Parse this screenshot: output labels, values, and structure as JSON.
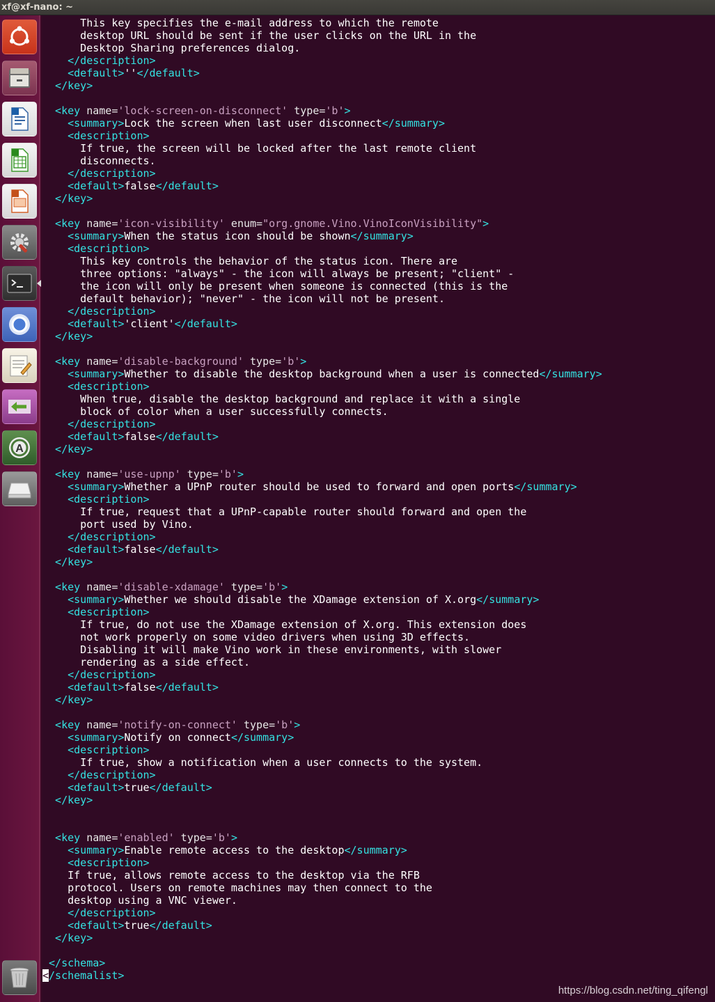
{
  "window": {
    "title": "xf@xf-nano: ~"
  },
  "launcher": {
    "items": [
      {
        "name": "ubuntu-dash-icon"
      },
      {
        "name": "files-icon"
      },
      {
        "name": "libreoffice-writer-icon"
      },
      {
        "name": "libreoffice-calc-icon"
      },
      {
        "name": "libreoffice-impress-icon"
      },
      {
        "name": "system-settings-icon"
      },
      {
        "name": "terminal-icon",
        "active": true
      },
      {
        "name": "chromium-icon"
      },
      {
        "name": "text-editor-icon"
      },
      {
        "name": "remote-desktop-icon"
      },
      {
        "name": "software-updater-icon"
      },
      {
        "name": "drive-icon"
      }
    ],
    "trash": {
      "name": "trash-icon"
    }
  },
  "watermark": "https://blog.csdn.net/ting_qifengl",
  "colors": {
    "tag": "#34e2e2",
    "text": "#ffffff",
    "value": "#c8a0c0",
    "background": "#300a24"
  },
  "lines": [
    [
      [
        "t",
        "      This key specifies the e-mail address to which the remote"
      ]
    ],
    [
      [
        "t",
        "      desktop URL should be sent if the user clicks on the URL in the"
      ]
    ],
    [
      [
        "t",
        "      Desktop Sharing preferences dialog."
      ]
    ],
    [
      [
        "g",
        "    </description>"
      ]
    ],
    [
      [
        "g",
        "    <default>"
      ],
      [
        "t",
        "''"
      ],
      [
        "g",
        "</default>"
      ]
    ],
    [
      [
        "g",
        "  </key>"
      ]
    ],
    [
      [
        "t",
        ""
      ]
    ],
    [
      [
        "g",
        "  <key "
      ],
      [
        "a",
        "name="
      ],
      [
        "v",
        "'lock-screen-on-disconnect'"
      ],
      [
        "a",
        " type="
      ],
      [
        "v",
        "'b'"
      ],
      [
        "g",
        ">"
      ]
    ],
    [
      [
        "g",
        "    <summary>"
      ],
      [
        "t",
        "Lock the screen when last user disconnect"
      ],
      [
        "g",
        "</summary>"
      ]
    ],
    [
      [
        "g",
        "    <description>"
      ]
    ],
    [
      [
        "t",
        "      If true, the screen will be locked after the last remote client"
      ]
    ],
    [
      [
        "t",
        "      disconnects."
      ]
    ],
    [
      [
        "g",
        "    </description>"
      ]
    ],
    [
      [
        "g",
        "    <default>"
      ],
      [
        "t",
        "false"
      ],
      [
        "g",
        "</default>"
      ]
    ],
    [
      [
        "g",
        "  </key>"
      ]
    ],
    [
      [
        "t",
        ""
      ]
    ],
    [
      [
        "g",
        "  <key "
      ],
      [
        "a",
        "name="
      ],
      [
        "v",
        "'icon-visibility'"
      ],
      [
        "a",
        " enum="
      ],
      [
        "v",
        "\"org.gnome.Vino.VinoIconVisibility\""
      ],
      [
        "g",
        ">"
      ]
    ],
    [
      [
        "g",
        "    <summary>"
      ],
      [
        "t",
        "When the status icon should be shown"
      ],
      [
        "g",
        "</summary>"
      ]
    ],
    [
      [
        "g",
        "    <description>"
      ]
    ],
    [
      [
        "t",
        "      This key controls the behavior of the status icon. There are"
      ]
    ],
    [
      [
        "t",
        "      three options: \"always\" - the icon will always be present; \"client\" -"
      ]
    ],
    [
      [
        "t",
        "      the icon will only be present when someone is connected (this is the"
      ]
    ],
    [
      [
        "t",
        "      default behavior); \"never\" - the icon will not be present."
      ]
    ],
    [
      [
        "g",
        "    </description>"
      ]
    ],
    [
      [
        "g",
        "    <default>"
      ],
      [
        "t",
        "'client'"
      ],
      [
        "g",
        "</default>"
      ]
    ],
    [
      [
        "g",
        "  </key>"
      ]
    ],
    [
      [
        "t",
        ""
      ]
    ],
    [
      [
        "g",
        "  <key "
      ],
      [
        "a",
        "name="
      ],
      [
        "v",
        "'disable-background'"
      ],
      [
        "a",
        " type="
      ],
      [
        "v",
        "'b'"
      ],
      [
        "g",
        ">"
      ]
    ],
    [
      [
        "g",
        "    <summary>"
      ],
      [
        "t",
        "Whether to disable the desktop background when a user is connected"
      ],
      [
        "g",
        "</summary>"
      ]
    ],
    [
      [
        "g",
        "    <description>"
      ]
    ],
    [
      [
        "t",
        "      When true, disable the desktop background and replace it with a single"
      ]
    ],
    [
      [
        "t",
        "      block of color when a user successfully connects."
      ]
    ],
    [
      [
        "g",
        "    </description>"
      ]
    ],
    [
      [
        "g",
        "    <default>"
      ],
      [
        "t",
        "false"
      ],
      [
        "g",
        "</default>"
      ]
    ],
    [
      [
        "g",
        "  </key>"
      ]
    ],
    [
      [
        "t",
        ""
      ]
    ],
    [
      [
        "g",
        "  <key "
      ],
      [
        "a",
        "name="
      ],
      [
        "v",
        "'use-upnp'"
      ],
      [
        "a",
        " type="
      ],
      [
        "v",
        "'b'"
      ],
      [
        "g",
        ">"
      ]
    ],
    [
      [
        "g",
        "    <summary>"
      ],
      [
        "t",
        "Whether a UPnP router should be used to forward and open ports"
      ],
      [
        "g",
        "</summary>"
      ]
    ],
    [
      [
        "g",
        "    <description>"
      ]
    ],
    [
      [
        "t",
        "      If true, request that a UPnP-capable router should forward and open the"
      ]
    ],
    [
      [
        "t",
        "      port used by Vino."
      ]
    ],
    [
      [
        "g",
        "    </description>"
      ]
    ],
    [
      [
        "g",
        "    <default>"
      ],
      [
        "t",
        "false"
      ],
      [
        "g",
        "</default>"
      ]
    ],
    [
      [
        "g",
        "  </key>"
      ]
    ],
    [
      [
        "t",
        ""
      ]
    ],
    [
      [
        "g",
        "  <key "
      ],
      [
        "a",
        "name="
      ],
      [
        "v",
        "'disable-xdamage'"
      ],
      [
        "a",
        " type="
      ],
      [
        "v",
        "'b'"
      ],
      [
        "g",
        ">"
      ]
    ],
    [
      [
        "g",
        "    <summary>"
      ],
      [
        "t",
        "Whether we should disable the XDamage extension of X.org"
      ],
      [
        "g",
        "</summary>"
      ]
    ],
    [
      [
        "g",
        "    <description>"
      ]
    ],
    [
      [
        "t",
        "      If true, do not use the XDamage extension of X.org. This extension does"
      ]
    ],
    [
      [
        "t",
        "      not work properly on some video drivers when using 3D effects."
      ]
    ],
    [
      [
        "t",
        "      Disabling it will make Vino work in these environments, with slower"
      ]
    ],
    [
      [
        "t",
        "      rendering as a side effect."
      ]
    ],
    [
      [
        "g",
        "    </description>"
      ]
    ],
    [
      [
        "g",
        "    <default>"
      ],
      [
        "t",
        "false"
      ],
      [
        "g",
        "</default>"
      ]
    ],
    [
      [
        "g",
        "  </key>"
      ]
    ],
    [
      [
        "t",
        ""
      ]
    ],
    [
      [
        "g",
        "  <key "
      ],
      [
        "a",
        "name="
      ],
      [
        "v",
        "'notify-on-connect'"
      ],
      [
        "a",
        " type="
      ],
      [
        "v",
        "'b'"
      ],
      [
        "g",
        ">"
      ]
    ],
    [
      [
        "g",
        "    <summary>"
      ],
      [
        "t",
        "Notify on connect"
      ],
      [
        "g",
        "</summary>"
      ]
    ],
    [
      [
        "g",
        "    <description>"
      ]
    ],
    [
      [
        "t",
        "      If true, show a notification when a user connects to the system."
      ]
    ],
    [
      [
        "g",
        "    </description>"
      ]
    ],
    [
      [
        "g",
        "    <default>"
      ],
      [
        "t",
        "true"
      ],
      [
        "g",
        "</default>"
      ]
    ],
    [
      [
        "g",
        "  </key>"
      ]
    ],
    [
      [
        "t",
        ""
      ]
    ],
    [
      [
        "t",
        ""
      ]
    ],
    [
      [
        "g",
        "  <key "
      ],
      [
        "a",
        "name="
      ],
      [
        "v",
        "'enabled'"
      ],
      [
        "a",
        " type="
      ],
      [
        "v",
        "'b'"
      ],
      [
        "g",
        ">"
      ]
    ],
    [
      [
        "g",
        "    <summary>"
      ],
      [
        "t",
        "Enable remote access to the desktop"
      ],
      [
        "g",
        "</summary>"
      ]
    ],
    [
      [
        "g",
        "    <description>"
      ]
    ],
    [
      [
        "t",
        "    If true, allows remote access to the desktop via the RFB"
      ]
    ],
    [
      [
        "t",
        "    protocol. Users on remote machines may then connect to the"
      ]
    ],
    [
      [
        "t",
        "    desktop using a VNC viewer."
      ]
    ],
    [
      [
        "g",
        "    </description>"
      ]
    ],
    [
      [
        "g",
        "    <default>"
      ],
      [
        "t",
        "true"
      ],
      [
        "g",
        "</default>"
      ]
    ],
    [
      [
        "g",
        "  </key>"
      ]
    ],
    [
      [
        "t",
        ""
      ]
    ],
    [
      [
        "g",
        " </schema>"
      ]
    ],
    [
      [
        "c",
        "<"
      ],
      [
        "g",
        "/schemalist>"
      ]
    ]
  ]
}
